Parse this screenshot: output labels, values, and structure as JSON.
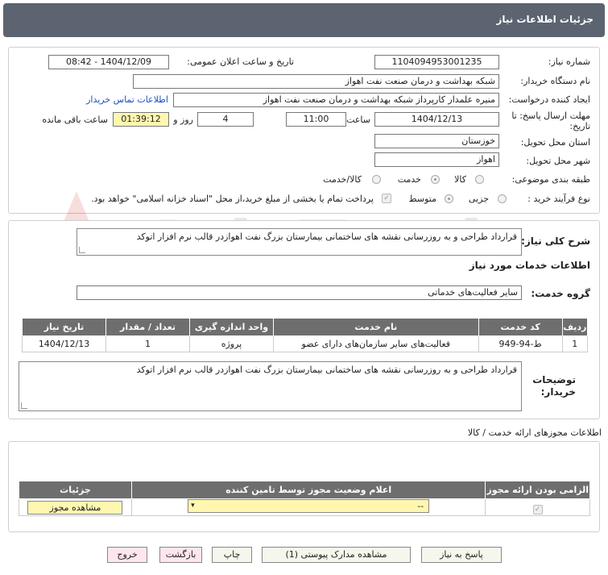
{
  "header": {
    "title": "جزئیات اطلاعات نیاز"
  },
  "form": {
    "need_number_label": "شماره نیاز:",
    "need_number": "1104094953001235",
    "announce_label": "تاریخ و ساعت اعلان عمومی:",
    "announce_value": "1404/12/09 - 08:42",
    "buyer_label": "نام دستگاه خریدار:",
    "buyer_value": "شبکه بهداشت و درمان صنعت نفت اهواز",
    "creator_label": "ایجاد کننده درخواست:",
    "creator_value": "منیره علمدار کارپرداز شبکه بهداشت و درمان صنعت نفت اهواز",
    "contact_link": "اطلاعات تماس خریدار",
    "deadline_label_1": "مهلت ارسال پاسخ: تا",
    "deadline_label_2": "تاریخ:",
    "deadline_date": "1404/12/13",
    "time_label": "ساعت",
    "deadline_time": "11:00",
    "days_value": "4",
    "days_label": "روز و",
    "remaining_time": "01:39:12",
    "remaining_label": "ساعت باقی مانده",
    "province_label": "استان محل تحویل:",
    "province_value": "خوزستان",
    "city_label": "شهر محل تحویل:",
    "city_value": "اهواز",
    "category_label": "طبقه بندی موضوعی:",
    "category_options": [
      "کالا",
      "خدمت",
      "کالا/خدمت"
    ],
    "process_label": "نوع فرآیند خرید :",
    "process_options": [
      "جزیی",
      "متوسط"
    ],
    "payment_note": "پرداخت تمام یا بخشی از مبلغ خرید،از محل \"اسناد خزانه اسلامی\" خواهد بود."
  },
  "description": {
    "label": "شرح کلی نیاز:",
    "value": "قرارداد طراحی و به روزرسانی نقشه های ساختمانی بیمارستان بزرگ نفت اهوازدر قالب نرم افزار اتوکد"
  },
  "services": {
    "section_title": "اطلاعات خدمات مورد نیاز",
    "group_label": "گروه خدمت:",
    "group_value": "سایر فعالیت‌های خدماتی",
    "table_headers": [
      "ردیف",
      "کد خدمت",
      "نام خدمت",
      "واحد اندازه گیری",
      "تعداد / مقدار",
      "تاریخ نیاز"
    ],
    "rows": [
      [
        "1",
        "ط-94-949",
        "فعالیت‌های سایر سازمان‌های دارای عضو",
        "پروژه",
        "1",
        "1404/12/13"
      ]
    ]
  },
  "buyer_notes": {
    "label_1": "توضیحات",
    "label_2": "خریدار:",
    "value": "قرارداد طراحی و به روزرسانی نقشه های ساختمانی بیمارستان بزرگ نفت اهوازدر قالب نرم افزار اتوکد"
  },
  "permits": {
    "section_title": "اطلاعات مجوزهای ارائه خدمت / کالا",
    "headers": [
      "الزامی بودن ارائه مجوز",
      "اعلام وضعیت مجوز توسط تامین کننده",
      "جزئیات"
    ],
    "select_value": "--",
    "view_button": "مشاهده مجوز"
  },
  "buttons": {
    "reply": "پاسخ به نیاز",
    "attachments": "مشاهده مدارک پیوستی (1)",
    "print": "چاپ",
    "back": "بازگشت",
    "exit": "خروج"
  },
  "watermark": {
    "text": "AriaTender.net"
  }
}
